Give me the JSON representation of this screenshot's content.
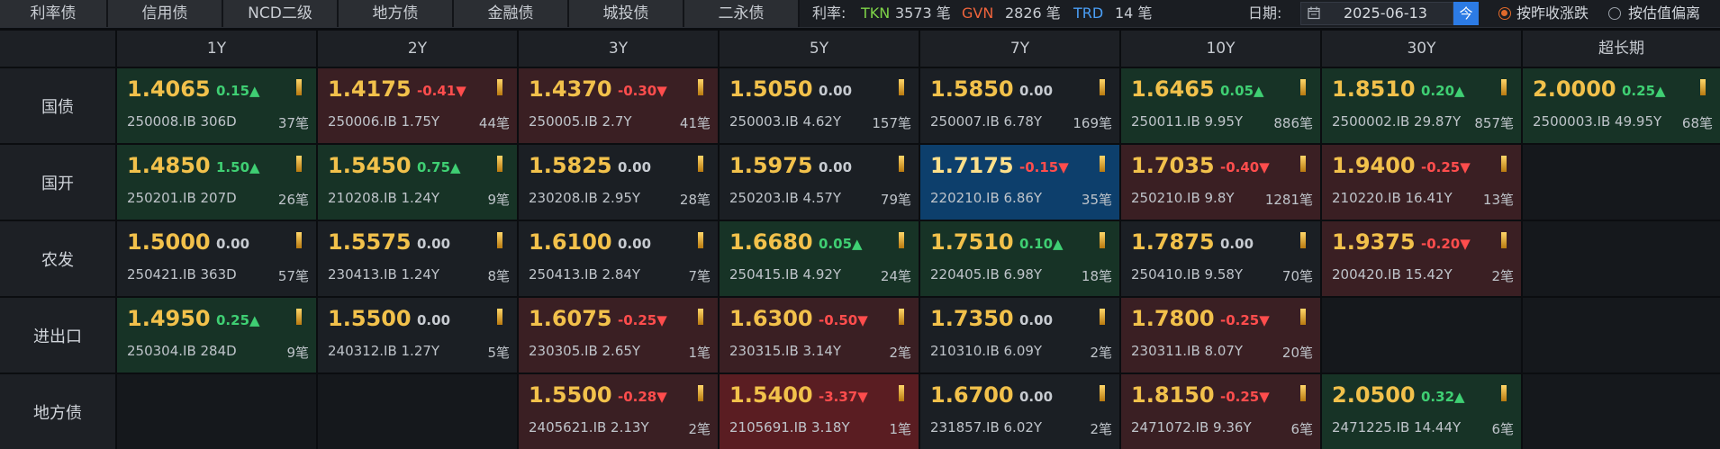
{
  "tabs": [
    {
      "label": "利率债",
      "active": true
    },
    {
      "label": "信用债",
      "active": false
    },
    {
      "label": "NCD二级",
      "active": false
    },
    {
      "label": "地方债",
      "active": false
    },
    {
      "label": "金融债",
      "active": false
    },
    {
      "label": "城投债",
      "active": false
    },
    {
      "label": "二永债",
      "active": false
    }
  ],
  "stats": {
    "label": "利率:",
    "tkn_label": "TKN",
    "tkn_count": "3573 笔",
    "gvn_label": "GVN",
    "gvn_count": "2826 笔",
    "trd_label": "TRD",
    "trd_count": "14 笔"
  },
  "date": {
    "label": "日期:",
    "value": "2025-06-13",
    "today_label": "今"
  },
  "options": {
    "opt1": "按昨收涨跌",
    "opt2": "按估值偏离",
    "selected": "opt1"
  },
  "colors": {
    "accent": "#d24c1c",
    "positive": "#3fcf73",
    "negative": "#ff4d4d",
    "rate": "#f2c14b",
    "tkn": "#7ed348",
    "gvn": "#f0643c",
    "trd": "#4a9ef5"
  },
  "columns": [
    "1Y",
    "2Y",
    "3Y",
    "5Y",
    "7Y",
    "10Y",
    "30Y",
    "超长期"
  ],
  "rows": [
    {
      "label": "国债",
      "cells": [
        {
          "rate": "1.4065",
          "chg": "0.15▲",
          "code": "250008.IB 306D",
          "count": "37笔",
          "state": "up"
        },
        {
          "rate": "1.4175",
          "chg": "-0.41▼",
          "code": "250006.IB 1.75Y",
          "count": "44笔",
          "state": "dn"
        },
        {
          "rate": "1.4370",
          "chg": "-0.30▼",
          "code": "250005.IB 2.7Y",
          "count": "41笔",
          "state": "dn"
        },
        {
          "rate": "1.5050",
          "chg": "0.00",
          "code": "250003.IB 4.62Y",
          "count": "157笔",
          "state": "neu"
        },
        {
          "rate": "1.5850",
          "chg": "0.00",
          "code": "250007.IB 6.78Y",
          "count": "169笔",
          "state": "neu"
        },
        {
          "rate": "1.6465",
          "chg": "0.05▲",
          "code": "250011.IB 9.95Y",
          "count": "886笔",
          "state": "up"
        },
        {
          "rate": "1.8510",
          "chg": "0.20▲",
          "code": "2500002.IB 29.87Y",
          "count": "857笔",
          "state": "up"
        },
        {
          "rate": "2.0000",
          "chg": "0.25▲",
          "code": "2500003.IB 49.95Y",
          "count": "68笔",
          "state": "up"
        }
      ]
    },
    {
      "label": "国开",
      "cells": [
        {
          "rate": "1.4850",
          "chg": "1.50▲",
          "code": "250201.IB 207D",
          "count": "26笔",
          "state": "up"
        },
        {
          "rate": "1.5450",
          "chg": "0.75▲",
          "code": "210208.IB 1.24Y",
          "count": "9笔",
          "state": "up"
        },
        {
          "rate": "1.5825",
          "chg": "0.00",
          "code": "230208.IB 2.95Y",
          "count": "28笔",
          "state": "neu"
        },
        {
          "rate": "1.5975",
          "chg": "0.00",
          "code": "250203.IB 4.57Y",
          "count": "79笔",
          "state": "neu"
        },
        {
          "rate": "1.7175",
          "chg": "-0.15▼",
          "code": "220210.IB 6.86Y",
          "count": "35笔",
          "state": "blue"
        },
        {
          "rate": "1.7035",
          "chg": "-0.40▼",
          "code": "250210.IB 9.8Y",
          "count": "1281笔",
          "state": "dn"
        },
        {
          "rate": "1.9400",
          "chg": "-0.25▼",
          "code": "210220.IB 16.41Y",
          "count": "13笔",
          "state": "dn"
        },
        null
      ]
    },
    {
      "label": "农发",
      "cells": [
        {
          "rate": "1.5000",
          "chg": "0.00",
          "code": "250421.IB 363D",
          "count": "57笔",
          "state": "neu"
        },
        {
          "rate": "1.5575",
          "chg": "0.00",
          "code": "230413.IB 1.24Y",
          "count": "8笔",
          "state": "neu"
        },
        {
          "rate": "1.6100",
          "chg": "0.00",
          "code": "250413.IB 2.84Y",
          "count": "7笔",
          "state": "neu"
        },
        {
          "rate": "1.6680",
          "chg": "0.05▲",
          "code": "250415.IB 4.92Y",
          "count": "24笔",
          "state": "up"
        },
        {
          "rate": "1.7510",
          "chg": "0.10▲",
          "code": "220405.IB 6.98Y",
          "count": "18笔",
          "state": "up"
        },
        {
          "rate": "1.7875",
          "chg": "0.00",
          "code": "250410.IB 9.58Y",
          "count": "70笔",
          "state": "neu"
        },
        {
          "rate": "1.9375",
          "chg": "-0.20▼",
          "code": "200420.IB 15.42Y",
          "count": "2笔",
          "state": "dn"
        },
        null
      ]
    },
    {
      "label": "进出口",
      "cells": [
        {
          "rate": "1.4950",
          "chg": "0.25▲",
          "code": "250304.IB 284D",
          "count": "9笔",
          "state": "up"
        },
        {
          "rate": "1.5500",
          "chg": "0.00",
          "code": "240312.IB 1.27Y",
          "count": "5笔",
          "state": "neu"
        },
        {
          "rate": "1.6075",
          "chg": "-0.25▼",
          "code": "230305.IB 2.65Y",
          "count": "1笔",
          "state": "dn"
        },
        {
          "rate": "1.6300",
          "chg": "-0.50▼",
          "code": "230315.IB 3.14Y",
          "count": "2笔",
          "state": "dn"
        },
        {
          "rate": "1.7350",
          "chg": "0.00",
          "code": "210310.IB 6.09Y",
          "count": "2笔",
          "state": "neu"
        },
        {
          "rate": "1.7800",
          "chg": "-0.25▼",
          "code": "230311.IB 8.07Y",
          "count": "20笔",
          "state": "dn"
        },
        null,
        null
      ]
    },
    {
      "label": "地方债",
      "cells": [
        null,
        null,
        {
          "rate": "1.5500",
          "chg": "-0.28▼",
          "code": "2405621.IB 2.13Y",
          "count": "2笔",
          "state": "dn"
        },
        {
          "rate": "1.5400",
          "chg": "-3.37▼",
          "code": "2105691.IB 3.18Y",
          "count": "1笔",
          "state": "dn2"
        },
        {
          "rate": "1.6700",
          "chg": "0.00",
          "code": "231857.IB 6.02Y",
          "count": "2笔",
          "state": "neu"
        },
        {
          "rate": "1.8150",
          "chg": "-0.25▼",
          "code": "2471072.IB 9.36Y",
          "count": "6笔",
          "state": "dn"
        },
        {
          "rate": "2.0500",
          "chg": "0.32▲",
          "code": "2471225.IB 14.44Y",
          "count": "6笔",
          "state": "up"
        },
        null
      ]
    }
  ]
}
